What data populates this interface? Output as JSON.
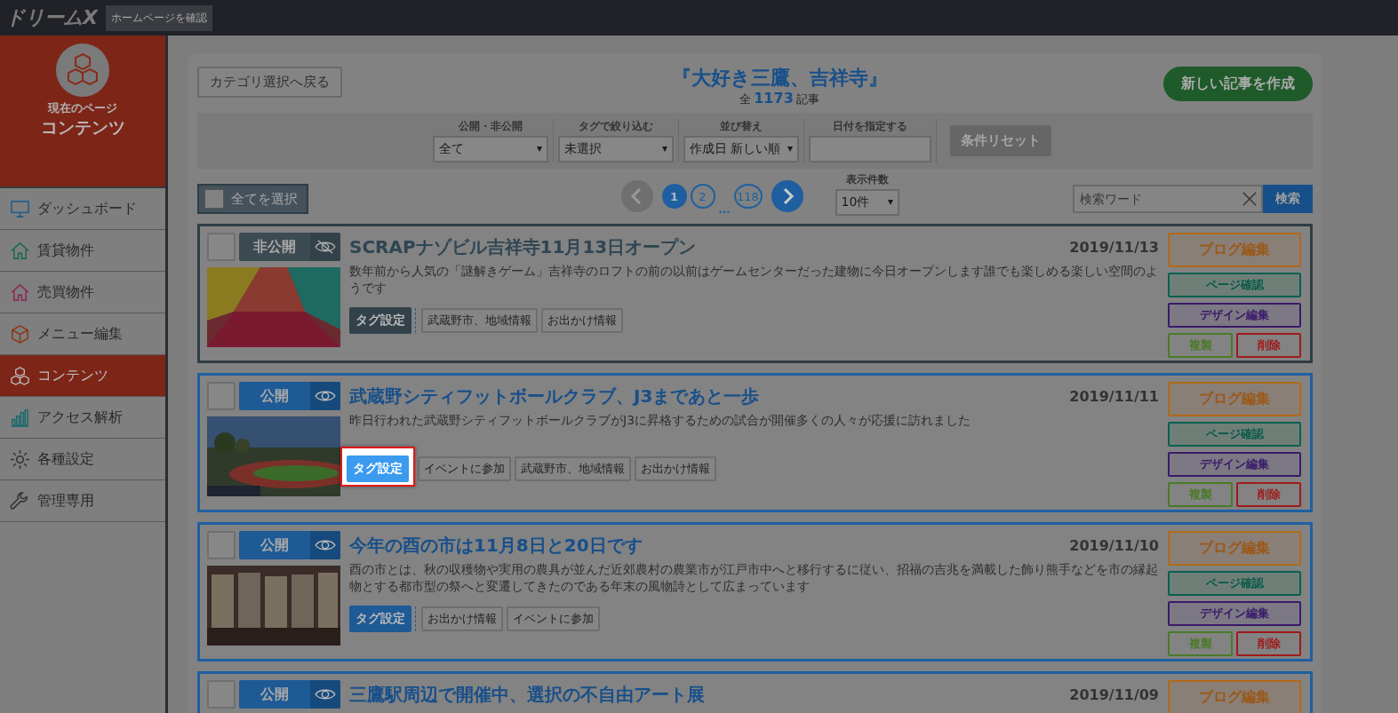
{
  "topbar": {
    "logo": "ドリームX",
    "homepage_button": "ホームページを確認"
  },
  "sidebar": {
    "current_caption": "現在のページ",
    "current_page": "コンテンツ",
    "items": [
      {
        "label": "ダッシュボード",
        "selected": false
      },
      {
        "label": "賃貸物件",
        "selected": false
      },
      {
        "label": "売買物件",
        "selected": false
      },
      {
        "label": "メニュー編集",
        "selected": false
      },
      {
        "label": "コンテンツ",
        "selected": true
      },
      {
        "label": "アクセス解析",
        "selected": false
      },
      {
        "label": "各種設定",
        "selected": false
      },
      {
        "label": "管理専用",
        "selected": false
      }
    ]
  },
  "header": {
    "back_button": "カテゴリ選択へ戻る",
    "title": "『大好き三鷹、吉祥寺』",
    "count_prefix": "全",
    "count": "1173",
    "count_suffix": "記事",
    "new_button": "新しい記事を作成"
  },
  "filters": [
    {
      "label": "公開・非公開",
      "value": "全て",
      "kind": "select"
    },
    {
      "label": "タグで絞り込む",
      "value": "未選択",
      "kind": "select"
    },
    {
      "label": "並び替え",
      "value": "作成日 新しい順",
      "kind": "select"
    },
    {
      "label": "日付を指定する",
      "kind": "date"
    }
  ],
  "reset_button": {
    "label": "条件リセット",
    "disabled": true
  },
  "toolbar": {
    "select_all": "全てを選択",
    "select_all_checked": false,
    "pages": [
      {
        "label": "1",
        "selected": true
      },
      {
        "label": "2",
        "selected": false
      },
      {
        "label": "…",
        "kind": "gap"
      },
      {
        "label": "118",
        "selected": false
      }
    ],
    "prev_disabled": true,
    "next_disabled": false,
    "per_page_label": "表示件数",
    "per_page": "10件",
    "search_placeholder": "検索ワード",
    "search_button": "検索"
  },
  "articles": [
    {
      "checked": false,
      "public": false,
      "status": "非公開",
      "title": "SCRAPナゾビル吉祥寺11月13日オープン",
      "date": "2019/11/13",
      "excerpt": "数年前から人気の「謎解きゲーム」吉祥寺のロフトの前の以前はゲームセンターだった建物に今日オープンします誰でも楽しめる楽しい空間のようです",
      "thumbnail": {
        "kind": "picture"
      },
      "tag_button": "タグ設定",
      "tag_button_highlighted": false,
      "tags": [
        "武蔵野市、地域情報",
        "お出かけ情報"
      ],
      "buttons": [
        {
          "label": "ブログ編集",
          "kind": "blog"
        },
        {
          "label": "ページ確認",
          "kind": "page"
        },
        {
          "label": "デザイン編集",
          "kind": "design"
        },
        {
          "label": "複製",
          "kind": "copy"
        },
        {
          "label": "削除",
          "kind": "delete"
        }
      ]
    },
    {
      "checked": false,
      "public": true,
      "status": "公開",
      "title": "武蔵野シティフットボールクラブ、J3まであと一歩",
      "date": "2019/11/11",
      "excerpt": "昨日行われた武蔵野シティフットボールクラブがJ3に昇格するための試合が開催多くの人々が応援に訪れました",
      "thumbnail": {
        "kind": "picture"
      },
      "tag_button": "タグ設定",
      "tag_button_highlighted": true,
      "tags": [
        "イベントに参加",
        "武蔵野市、地域情報",
        "お出かけ情報"
      ],
      "buttons": [
        {
          "label": "ブログ編集",
          "kind": "blog"
        },
        {
          "label": "ページ確認",
          "kind": "page"
        },
        {
          "label": "デザイン編集",
          "kind": "design"
        },
        {
          "label": "複製",
          "kind": "copy"
        },
        {
          "label": "削除",
          "kind": "delete"
        }
      ]
    },
    {
      "checked": false,
      "public": true,
      "status": "公開",
      "title": "今年の酉の市は11月8日と20日です",
      "date": "2019/11/10",
      "excerpt": "酉の市とは、秋の収穫物や実用の農具が並んだ近郊農村の農業市が江戸市中へと移行するに従い、招福の吉兆を満載した飾り熊手などを市の縁起物とする都市型の祭へと変遷してきたのである年末の風物詩として広まっています",
      "thumbnail": {
        "kind": "picture"
      },
      "tag_button": "タグ設定",
      "tag_button_highlighted": false,
      "tags": [
        "お出かけ情報",
        "イベントに参加"
      ],
      "buttons": [
        {
          "label": "ブログ編集",
          "kind": "blog"
        },
        {
          "label": "ページ確認",
          "kind": "page"
        },
        {
          "label": "デザイン編集",
          "kind": "design"
        },
        {
          "label": "複製",
          "kind": "copy"
        },
        {
          "label": "削除",
          "kind": "delete"
        }
      ]
    },
    {
      "checked": false,
      "public": true,
      "status": "公開",
      "title": "三鷹駅周辺で開催中、選択の不自由アート展",
      "date": "2019/11/09",
      "buttons": [
        {
          "label": "ブログ編集",
          "kind": "blog"
        }
      ]
    }
  ]
}
